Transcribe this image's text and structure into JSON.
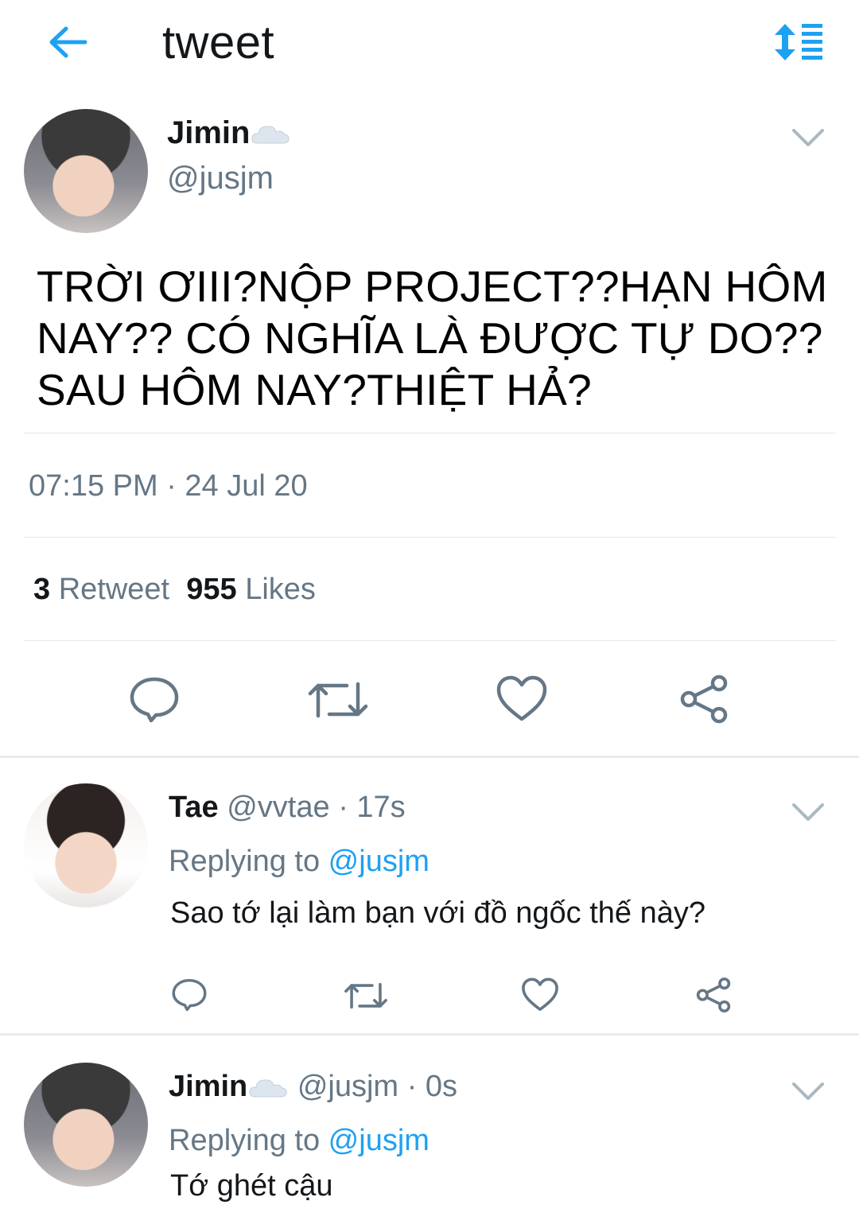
{
  "header": {
    "title": "tweet",
    "back_icon": "back-arrow-icon",
    "sort_icon": "sort-list-icon"
  },
  "colors": {
    "accent": "#1da1f2",
    "muted": "#657786",
    "divider": "#e1e8ed"
  },
  "tweet": {
    "author_name": "Jimin",
    "author_handle": "@jusjm",
    "text": "TRỜI ƠIII?NỘP PROJECT??HẠN HÔM NAY?? CÓ NGHĨA LÀ ĐƯỢC TỰ DO?? SAU HÔM NAY?THIỆT HẢ?",
    "timestamp": "07:15 PM · 24 Jul 20",
    "retweet_count": "3",
    "retweet_label": " Retweet",
    "like_count": "955",
    "like_label": " Likes"
  },
  "replies": [
    {
      "name": "Tae",
      "handle": "@vvtae",
      "time": " · 17s",
      "replying_label": "Replying to ",
      "replying_to": "@jusjm",
      "text": "Sao tớ lại làm bạn với đồ ngốc thế này?"
    },
    {
      "name": "Jimin",
      "handle": "@jusjm",
      "time": " · 0s",
      "replying_label": "Replying to ",
      "replying_to": "@jusjm",
      "text": "Tớ ghét cậu"
    }
  ]
}
